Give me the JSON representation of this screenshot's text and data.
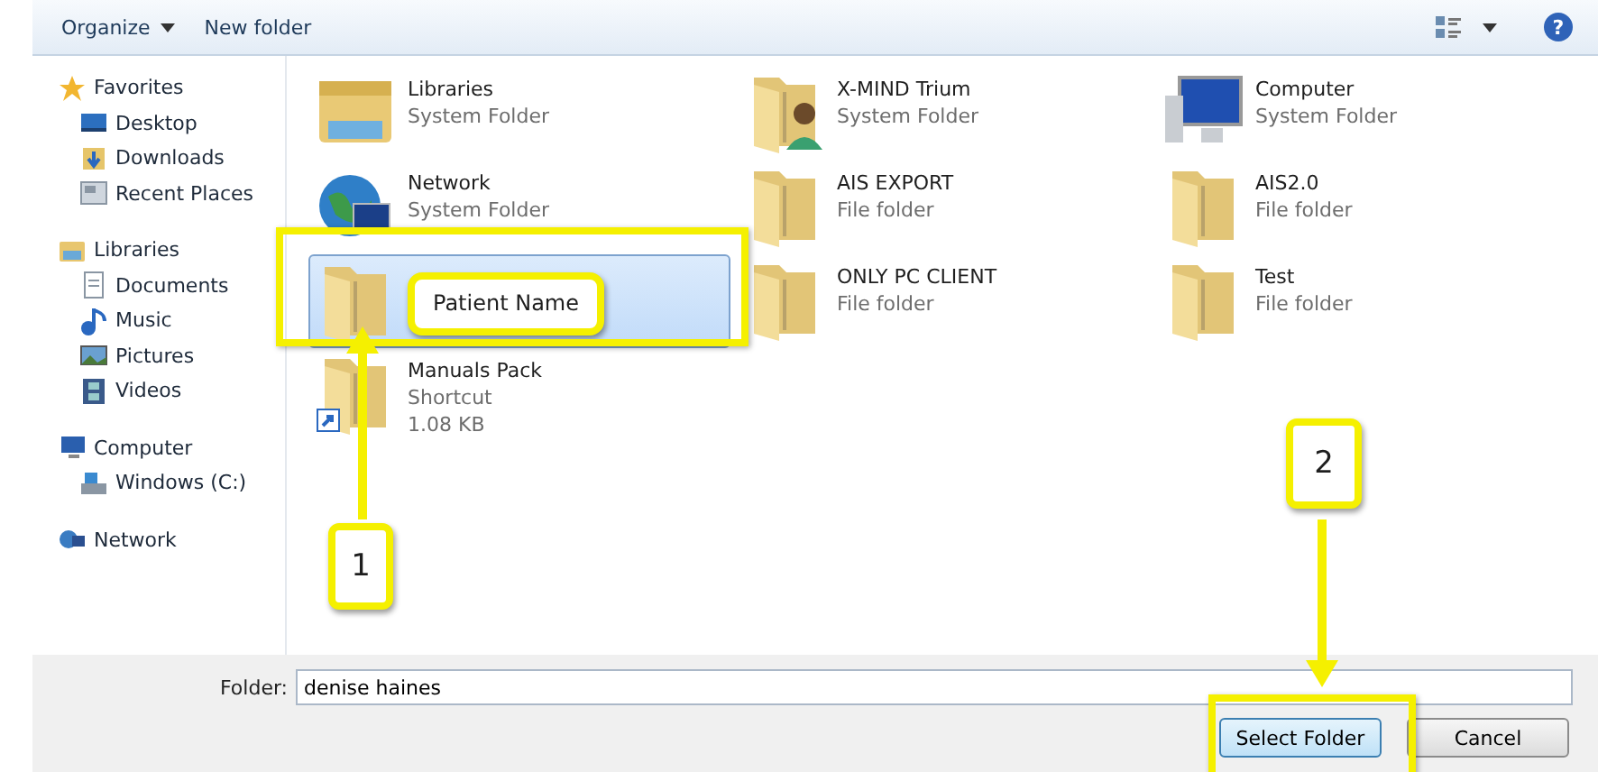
{
  "toolbar": {
    "organize": "Organize",
    "new_folder": "New folder",
    "help": "?"
  },
  "sidebar": {
    "groups": [
      {
        "label": "Favorites",
        "kind": "star",
        "children": [
          {
            "label": "Desktop",
            "kind": "desktop"
          },
          {
            "label": "Downloads",
            "kind": "downloads"
          },
          {
            "label": "Recent Places",
            "kind": "recent"
          }
        ]
      },
      {
        "label": "Libraries",
        "kind": "libraries",
        "children": [
          {
            "label": "Documents",
            "kind": "documents"
          },
          {
            "label": "Music",
            "kind": "music"
          },
          {
            "label": "Pictures",
            "kind": "pictures"
          },
          {
            "label": "Videos",
            "kind": "videos"
          }
        ]
      },
      {
        "label": "Computer",
        "kind": "computer",
        "children": [
          {
            "label": "Windows (C:)",
            "kind": "drive"
          }
        ]
      },
      {
        "label": "Network",
        "kind": "network"
      }
    ]
  },
  "items": [
    {
      "name": "Libraries",
      "detail": "System Folder",
      "kind": "libraries",
      "selected": false
    },
    {
      "name": "X-MIND Trium",
      "detail": "System Folder",
      "kind": "user-folder",
      "selected": false
    },
    {
      "name": "Computer",
      "detail": "System Folder",
      "kind": "computer",
      "selected": false
    },
    {
      "name": "Network",
      "detail": "System Folder",
      "kind": "network",
      "selected": false
    },
    {
      "name": "AIS EXPORT",
      "detail": "File folder",
      "kind": "folder",
      "selected": false
    },
    {
      "name": "AIS2.0",
      "detail": "File folder",
      "kind": "folder",
      "selected": false
    },
    {
      "name": "Patient Name",
      "kind": "folder",
      "selected": true
    },
    {
      "name": "ONLY PC CLIENT",
      "detail": "File folder",
      "kind": "folder",
      "selected": false
    },
    {
      "name": "Test",
      "detail": "File folder",
      "kind": "folder",
      "selected": false
    },
    {
      "name": "Manuals Pack",
      "detail": "Shortcut",
      "size": "1.08 KB",
      "kind": "shortcut",
      "selected": false
    }
  ],
  "folder_field": {
    "label": "Folder:",
    "value": "denise haines"
  },
  "buttons": [
    {
      "label": "Select Folder",
      "kind": "primary"
    },
    {
      "label": "Cancel",
      "kind": "normal"
    }
  ],
  "annotations": [
    {
      "label": "1",
      "kind": "up"
    },
    {
      "label": "2",
      "kind": "down"
    }
  ]
}
